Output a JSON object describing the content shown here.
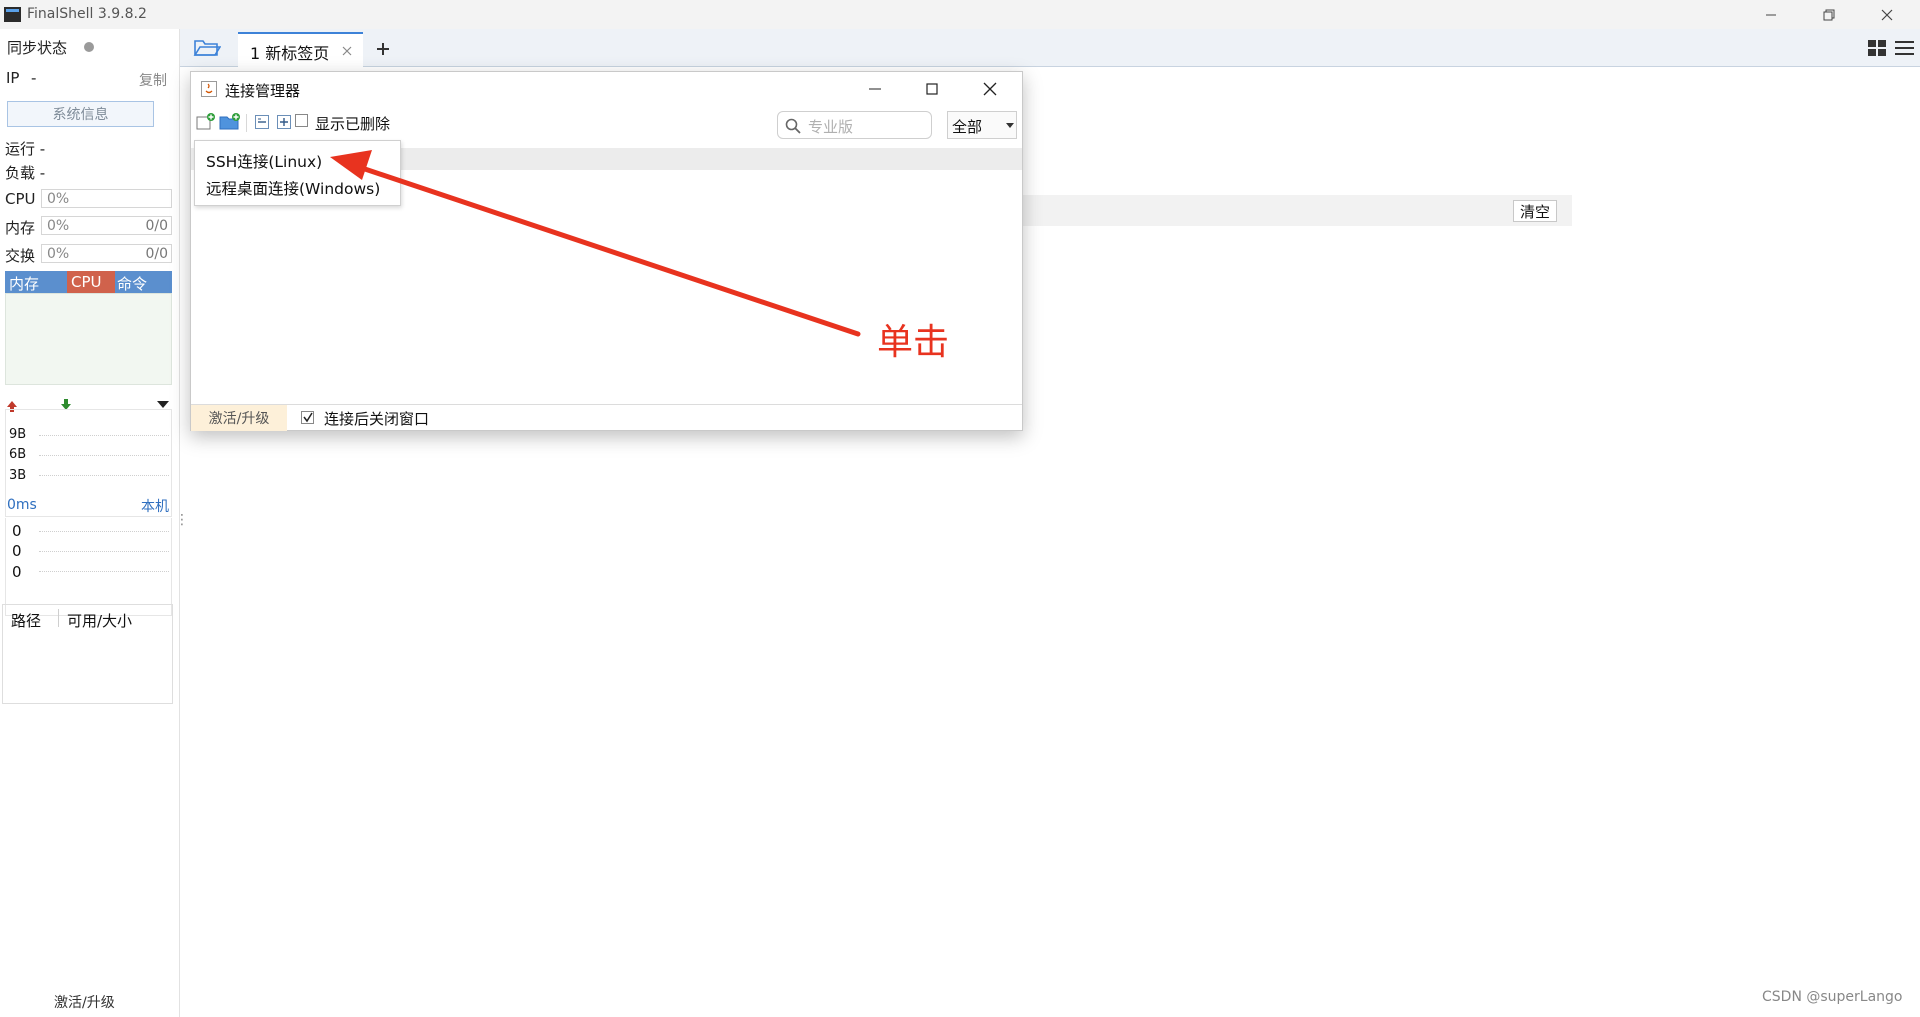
{
  "window": {
    "title": "FinalShell 3.9.8.2"
  },
  "sidebar": {
    "sync_label": "同步状态",
    "ip_label": "IP",
    "ip_value": "-",
    "copy_label": "复制",
    "sysinfo_button": "系统信息",
    "run_label": "运行 -",
    "load_label": "负载 -",
    "cpu": {
      "label": "CPU",
      "value": "0%"
    },
    "mem": {
      "label": "内存",
      "value": "0%",
      "ratio": "0/0"
    },
    "swap": {
      "label": "交换",
      "value": "0%",
      "ratio": "0/0"
    },
    "monitor_tabs": [
      "内存",
      "CPU",
      "命令"
    ],
    "net_scale": [
      "9B",
      "6B",
      "3B"
    ],
    "ping_label": "0ms",
    "ping_host": "本机",
    "ping_values": [
      "0",
      "0",
      "0"
    ],
    "disk_headers": [
      "路径",
      "可用/大小"
    ],
    "activate_label": "激活/升级"
  },
  "tabs": {
    "active_label": "1 新标签页"
  },
  "dialog": {
    "title": "连接管理器",
    "show_deleted_label": "显示已删除",
    "search_placeholder": "专业版",
    "filter_value": "全部",
    "menu_items": [
      "SSH连接(Linux)",
      "远程桌面连接(Windows)"
    ],
    "footer_activate": "激活/升级",
    "close_after_connect_label": "连接后关闭窗口"
  },
  "main": {
    "clear_button": "清空"
  },
  "annotation": {
    "text": "单击",
    "color": "#e8331f"
  },
  "watermark": "CSDN @superLango",
  "colors": {
    "accent": "#3d82d8",
    "cpu_tab": "#d0624c",
    "monitor_tab": "#5b8fce"
  }
}
